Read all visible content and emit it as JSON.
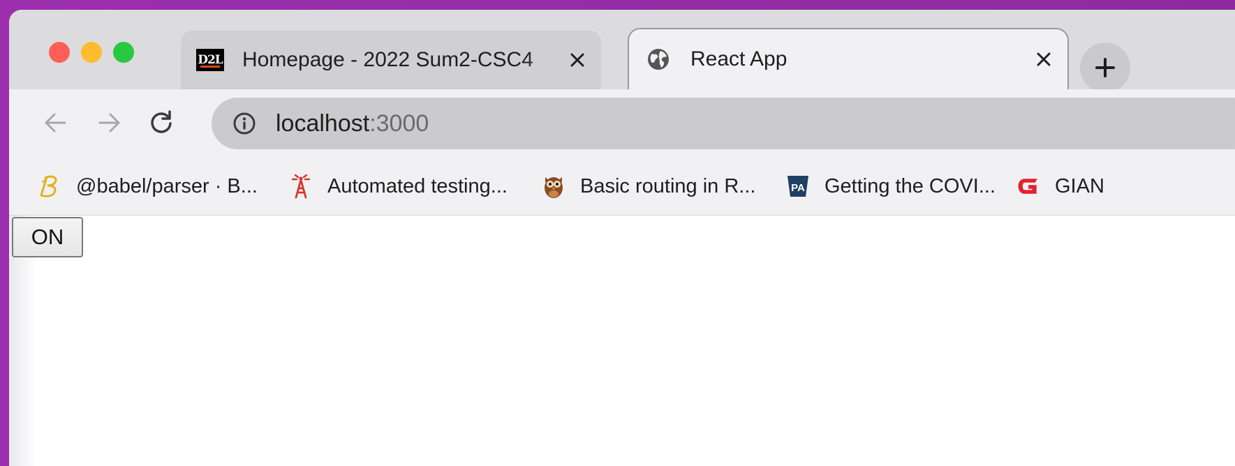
{
  "window_controls": {
    "close": "close",
    "minimize": "minimize",
    "zoom": "zoom"
  },
  "tabs": [
    {
      "title": "Homepage - 2022 Sum2-CSC4",
      "favicon": "D2L",
      "active": false,
      "close_icon": "close-icon"
    },
    {
      "title": "React App",
      "favicon": "globe-icon",
      "active": true,
      "close_icon": "close-icon"
    }
  ],
  "new_tab_icon": "plus-icon",
  "toolbar": {
    "back_icon": "arrow-left-icon",
    "forward_icon": "arrow-right-icon",
    "reload_icon": "reload-icon",
    "site_info_icon": "info-icon",
    "url_host": "localhost",
    "url_port": ":3000"
  },
  "bookmarks": [
    {
      "label": "@babel/parser · B...",
      "icon": "babel-icon"
    },
    {
      "label": "Automated testing...",
      "icon": "tower-icon"
    },
    {
      "label": "Basic routing in R...",
      "icon": "owl-icon"
    },
    {
      "label": "Getting the COVI...",
      "icon": "pa-keystone-icon"
    },
    {
      "label": "GIAN",
      "icon": "giant-g-icon"
    }
  ],
  "page": {
    "toggle_button_label": "ON"
  },
  "colors": {
    "close_dot": "#ff5f57",
    "minimize_dot": "#febc2e",
    "zoom_dot": "#28c840",
    "tabstrip_bg": "#dcdcde",
    "toolbar_bg": "#f1f1f3",
    "omnibox_bg": "#cbcbcd"
  }
}
